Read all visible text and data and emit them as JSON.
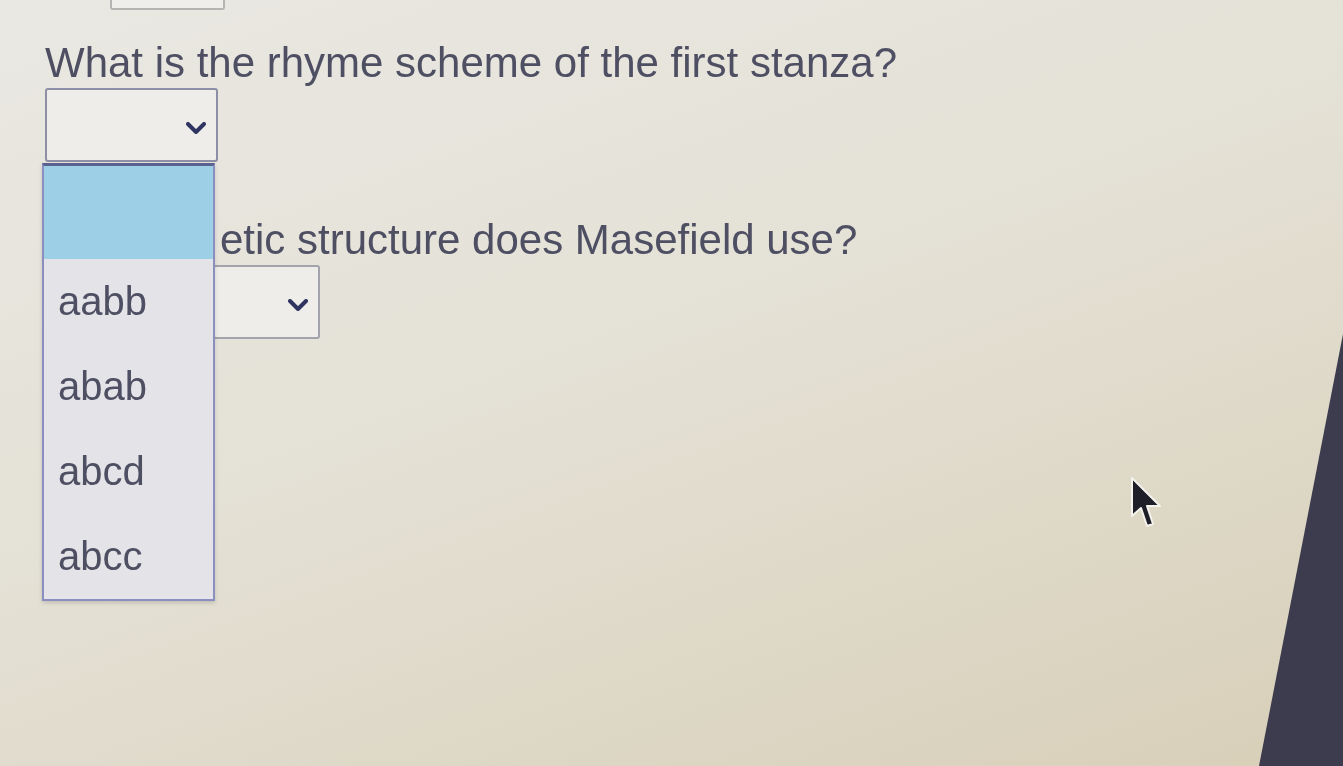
{
  "questions": [
    {
      "prompt": "What is the rhyme scheme of the first stanza?",
      "select": {
        "expanded": true,
        "options": [
          {
            "selected": true
          },
          {
            "label": "aabb",
            "selected": false
          },
          {
            "label": "abab",
            "selected": false
          },
          {
            "label": "abcd",
            "selected": false
          },
          {
            "label": "abcc",
            "selected": false
          }
        ]
      }
    },
    {
      "prompt": "etic structure does Masefield use?",
      "select": {
        "expanded": false
      }
    }
  ]
}
